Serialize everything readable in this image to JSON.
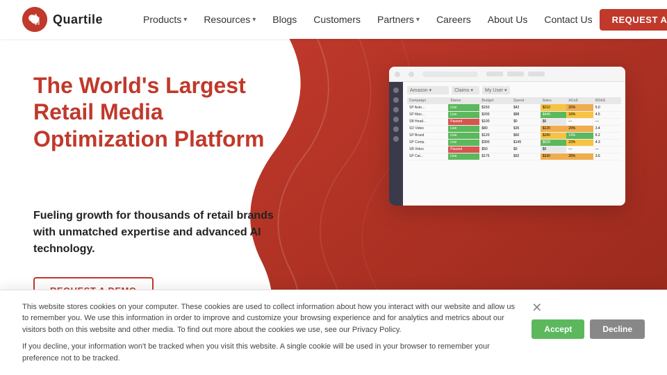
{
  "brand": {
    "name": "Quartile"
  },
  "nav": {
    "links": [
      {
        "label": "Products",
        "hasDropdown": true,
        "name": "nav-products"
      },
      {
        "label": "Resources",
        "hasDropdown": true,
        "name": "nav-resources"
      },
      {
        "label": "Blogs",
        "hasDropdown": false,
        "name": "nav-blogs"
      },
      {
        "label": "Customers",
        "hasDropdown": false,
        "name": "nav-customers"
      },
      {
        "label": "Partners",
        "hasDropdown": true,
        "name": "nav-partners"
      },
      {
        "label": "Careers",
        "hasDropdown": false,
        "name": "nav-careers"
      },
      {
        "label": "About Us",
        "hasDropdown": false,
        "name": "nav-about"
      },
      {
        "label": "Contact Us",
        "hasDropdown": false,
        "name": "nav-contact"
      }
    ],
    "cta": "REQUEST A DEMO"
  },
  "hero": {
    "title": "The World's Largest Retail Media Optimization Platform",
    "subtitle": "Fueling growth for thousands of retail brands with unmatched expertise and advanced AI technology.",
    "cta": "REQUEST A DEMO"
  },
  "cookie": {
    "text1": "This website stores cookies on your computer. These cookies are used to collect information about how you interact with our website and allow us to remember you. We use this information in order to improve and customize your browsing experience and for analytics and metrics about our visitors both on this website and other media. To find out more about the cookies we use, see our Privacy Policy.",
    "text2": "If you decline, your information won't be tracked when you visit this website. A single cookie will be used in your browser to remember your preference not to be tracked.",
    "accept": "Accept",
    "decline": "Decline"
  }
}
